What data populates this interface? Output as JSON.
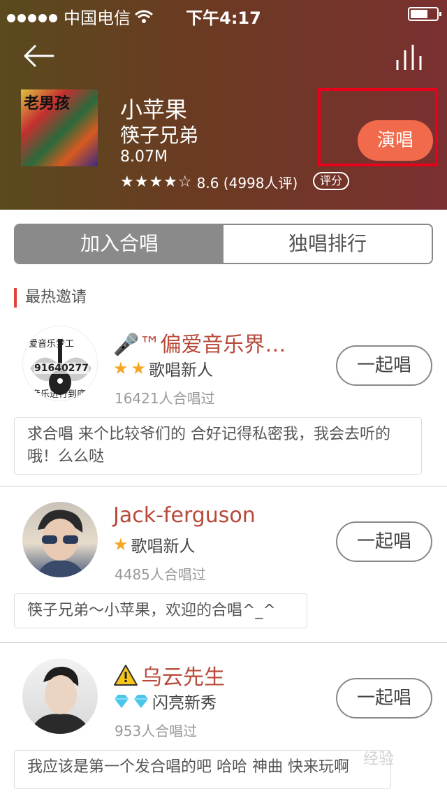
{
  "status": {
    "carrier": "中国电信",
    "time": "下午4:17"
  },
  "song": {
    "title": "小苹果",
    "artist": "筷子兄弟",
    "size": "8.07M",
    "stars": "★★★★☆",
    "rating": "8.6 (4998人评)",
    "rate_label": "评分",
    "sing_label": "演唱",
    "cover_text": "老男孩"
  },
  "tabs": [
    {
      "label": "加入合唱"
    },
    {
      "label": "独唱排行"
    }
  ],
  "section_label": "最热邀请",
  "entries": [
    {
      "name": "🎤™偏爱音乐界…",
      "level": "歌唱新人",
      "count": "16421人合唱过",
      "button": "一起唱",
      "message": "求合唱 来个比较爷们的 合好记得私密我，我会去听的哦！么么哒",
      "avatar_top": "爱音乐梦工",
      "avatar_num": "91640277",
      "avatar_bottom": "音乐进行到底"
    },
    {
      "name": "Jack-ferguson",
      "level": "歌唱新人",
      "count": "4485人合唱过",
      "button": "一起唱",
      "message": "筷子兄弟～小苹果，欢迎的合唱^_^"
    },
    {
      "name": "乌云先生",
      "level": "闪亮新秀",
      "count": "953人合唱过",
      "button": "一起唱",
      "message": "我应该是第一个发合唱的吧 哈哈 神曲 快来玩啊"
    }
  ],
  "watermark": "经验"
}
